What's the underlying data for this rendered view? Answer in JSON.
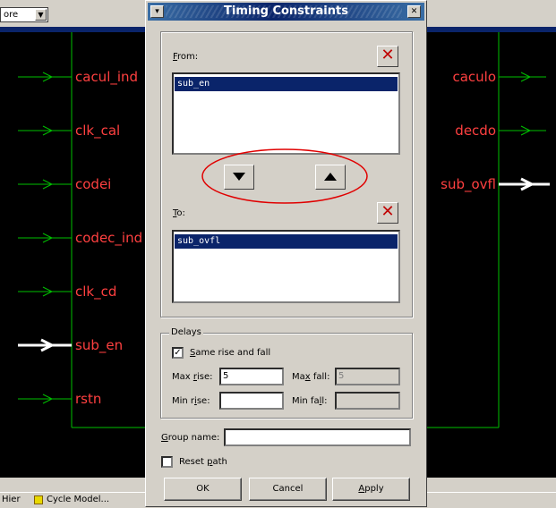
{
  "background_app": {
    "combo_value": "ore",
    "left_ports": [
      "cacul_ind",
      "clk_cal",
      "codei",
      "codec_ind",
      "clk_cd",
      "sub_en",
      "rstn"
    ],
    "right_ports": [
      "caculo",
      "decdo",
      "sub_ovfl"
    ],
    "status_items": [
      "Hier",
      "Cycle Model..."
    ]
  },
  "dialog": {
    "title": "Timing Constraints",
    "from": {
      "label_prefix": "",
      "label_accel": "F",
      "label_rest": "rom:",
      "items": [
        "sub_en"
      ]
    },
    "to": {
      "label_accel": "T",
      "label_rest": "o:",
      "items": [
        "sub_ovfl"
      ]
    },
    "delays": {
      "group_label": "Delays",
      "same_rise_fall": {
        "accel": "S",
        "rest": "ame rise and fall",
        "checked": "✓"
      },
      "max_rise": {
        "pre": "Max ",
        "accel": "r",
        "rest": "ise:",
        "value": "5"
      },
      "max_fall": {
        "pre": "Ma",
        "accel": "x",
        "rest": " fall:",
        "value": "5"
      },
      "min_rise": {
        "pre": "Min r",
        "accel": "i",
        "rest": "se:",
        "value": ""
      },
      "min_fall": {
        "pre": "Min fa",
        "accel": "l",
        "rest": "l:",
        "value": ""
      }
    },
    "group_name": {
      "accel": "G",
      "rest": "roup name:",
      "value": ""
    },
    "reset_path": {
      "pre": "Reset ",
      "accel": "p",
      "rest": "ath"
    },
    "buttons": {
      "ok": "OK",
      "cancel": "Cancel",
      "apply_accel": "A",
      "apply_rest": "pply"
    }
  },
  "colors": {
    "wire": "#00c000",
    "port_text": "#ff4040",
    "selection": "#0a246a",
    "annotation": "#e00000"
  }
}
